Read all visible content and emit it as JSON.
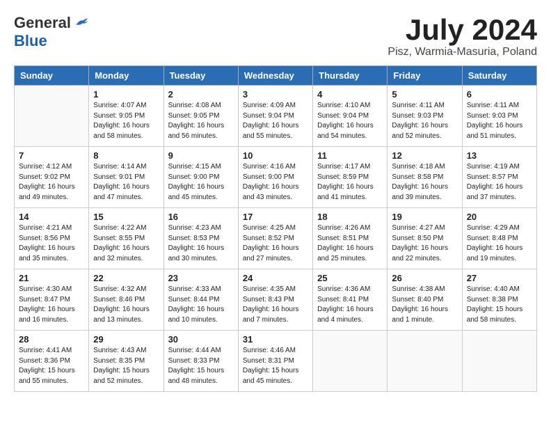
{
  "header": {
    "logo_general": "General",
    "logo_blue": "Blue",
    "title": "July 2024",
    "location": "Pisz, Warmia-Masuria, Poland"
  },
  "weekdays": [
    "Sunday",
    "Monday",
    "Tuesday",
    "Wednesday",
    "Thursday",
    "Friday",
    "Saturday"
  ],
  "weeks": [
    [
      {
        "day": "",
        "info": ""
      },
      {
        "day": "1",
        "info": "Sunrise: 4:07 AM\nSunset: 9:05 PM\nDaylight: 16 hours\nand 58 minutes."
      },
      {
        "day": "2",
        "info": "Sunrise: 4:08 AM\nSunset: 9:05 PM\nDaylight: 16 hours\nand 56 minutes."
      },
      {
        "day": "3",
        "info": "Sunrise: 4:09 AM\nSunset: 9:04 PM\nDaylight: 16 hours\nand 55 minutes."
      },
      {
        "day": "4",
        "info": "Sunrise: 4:10 AM\nSunset: 9:04 PM\nDaylight: 16 hours\nand 54 minutes."
      },
      {
        "day": "5",
        "info": "Sunrise: 4:11 AM\nSunset: 9:03 PM\nDaylight: 16 hours\nand 52 minutes."
      },
      {
        "day": "6",
        "info": "Sunrise: 4:11 AM\nSunset: 9:03 PM\nDaylight: 16 hours\nand 51 minutes."
      }
    ],
    [
      {
        "day": "7",
        "info": "Sunrise: 4:12 AM\nSunset: 9:02 PM\nDaylight: 16 hours\nand 49 minutes."
      },
      {
        "day": "8",
        "info": "Sunrise: 4:14 AM\nSunset: 9:01 PM\nDaylight: 16 hours\nand 47 minutes."
      },
      {
        "day": "9",
        "info": "Sunrise: 4:15 AM\nSunset: 9:00 PM\nDaylight: 16 hours\nand 45 minutes."
      },
      {
        "day": "10",
        "info": "Sunrise: 4:16 AM\nSunset: 9:00 PM\nDaylight: 16 hours\nand 43 minutes."
      },
      {
        "day": "11",
        "info": "Sunrise: 4:17 AM\nSunset: 8:59 PM\nDaylight: 16 hours\nand 41 minutes."
      },
      {
        "day": "12",
        "info": "Sunrise: 4:18 AM\nSunset: 8:58 PM\nDaylight: 16 hours\nand 39 minutes."
      },
      {
        "day": "13",
        "info": "Sunrise: 4:19 AM\nSunset: 8:57 PM\nDaylight: 16 hours\nand 37 minutes."
      }
    ],
    [
      {
        "day": "14",
        "info": "Sunrise: 4:21 AM\nSunset: 8:56 PM\nDaylight: 16 hours\nand 35 minutes."
      },
      {
        "day": "15",
        "info": "Sunrise: 4:22 AM\nSunset: 8:55 PM\nDaylight: 16 hours\nand 32 minutes."
      },
      {
        "day": "16",
        "info": "Sunrise: 4:23 AM\nSunset: 8:53 PM\nDaylight: 16 hours\nand 30 minutes."
      },
      {
        "day": "17",
        "info": "Sunrise: 4:25 AM\nSunset: 8:52 PM\nDaylight: 16 hours\nand 27 minutes."
      },
      {
        "day": "18",
        "info": "Sunrise: 4:26 AM\nSunset: 8:51 PM\nDaylight: 16 hours\nand 25 minutes."
      },
      {
        "day": "19",
        "info": "Sunrise: 4:27 AM\nSunset: 8:50 PM\nDaylight: 16 hours\nand 22 minutes."
      },
      {
        "day": "20",
        "info": "Sunrise: 4:29 AM\nSunset: 8:48 PM\nDaylight: 16 hours\nand 19 minutes."
      }
    ],
    [
      {
        "day": "21",
        "info": "Sunrise: 4:30 AM\nSunset: 8:47 PM\nDaylight: 16 hours\nand 16 minutes."
      },
      {
        "day": "22",
        "info": "Sunrise: 4:32 AM\nSunset: 8:46 PM\nDaylight: 16 hours\nand 13 minutes."
      },
      {
        "day": "23",
        "info": "Sunrise: 4:33 AM\nSunset: 8:44 PM\nDaylight: 16 hours\nand 10 minutes."
      },
      {
        "day": "24",
        "info": "Sunrise: 4:35 AM\nSunset: 8:43 PM\nDaylight: 16 hours\nand 7 minutes."
      },
      {
        "day": "25",
        "info": "Sunrise: 4:36 AM\nSunset: 8:41 PM\nDaylight: 16 hours\nand 4 minutes."
      },
      {
        "day": "26",
        "info": "Sunrise: 4:38 AM\nSunset: 8:40 PM\nDaylight: 16 hours\nand 1 minute."
      },
      {
        "day": "27",
        "info": "Sunrise: 4:40 AM\nSunset: 8:38 PM\nDaylight: 15 hours\nand 58 minutes."
      }
    ],
    [
      {
        "day": "28",
        "info": "Sunrise: 4:41 AM\nSunset: 8:36 PM\nDaylight: 15 hours\nand 55 minutes."
      },
      {
        "day": "29",
        "info": "Sunrise: 4:43 AM\nSunset: 8:35 PM\nDaylight: 15 hours\nand 52 minutes."
      },
      {
        "day": "30",
        "info": "Sunrise: 4:44 AM\nSunset: 8:33 PM\nDaylight: 15 hours\nand 48 minutes."
      },
      {
        "day": "31",
        "info": "Sunrise: 4:46 AM\nSunset: 8:31 PM\nDaylight: 15 hours\nand 45 minutes."
      },
      {
        "day": "",
        "info": ""
      },
      {
        "day": "",
        "info": ""
      },
      {
        "day": "",
        "info": ""
      }
    ]
  ]
}
